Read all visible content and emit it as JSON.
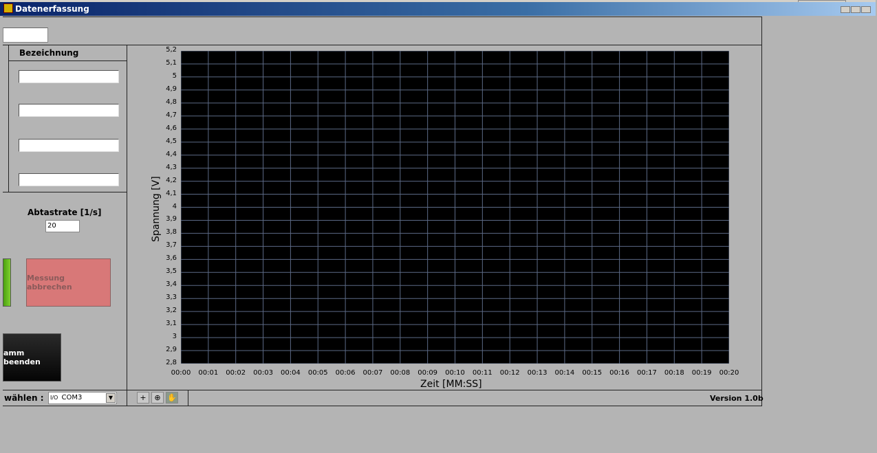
{
  "window": {
    "title": "Datenerfassung"
  },
  "channels": {
    "header": "Bezeichnung",
    "fields": [
      "",
      "",
      "",
      ""
    ]
  },
  "sampling": {
    "label": "Abtastrate [1/s]",
    "value": "20"
  },
  "buttons": {
    "abort": "Messung abbrechen",
    "quit": "amm beenden"
  },
  "port": {
    "label": "wählen :",
    "value": "COM3",
    "io_prefix": "I/O"
  },
  "graph": {
    "ylabel": "Spannung [V]",
    "xlabel": "Zeit [MM:SS]",
    "grid_color": "#5c6a86"
  },
  "version": "Version 1.0b",
  "chart_data": {
    "type": "line",
    "xlabel": "Zeit [MM:SS]",
    "ylabel": "Spannung [V]",
    "ylim": [
      2.8,
      5.2
    ],
    "yticks": [
      "2,8",
      "2,9",
      "3",
      "3,1",
      "3,2",
      "3,3",
      "3,4",
      "3,5",
      "3,6",
      "3,7",
      "3,8",
      "3,9",
      "4",
      "4,1",
      "4,2",
      "4,3",
      "4,4",
      "4,5",
      "4,6",
      "4,7",
      "4,8",
      "4,9",
      "5",
      "5,1",
      "5,2"
    ],
    "xticks": [
      "00:00",
      "00:01",
      "00:02",
      "00:03",
      "00:04",
      "00:05",
      "00:06",
      "00:07",
      "00:08",
      "00:09",
      "00:10",
      "00:11",
      "00:12",
      "00:13",
      "00:14",
      "00:15",
      "00:16",
      "00:17",
      "00:18",
      "00:19",
      "00:20"
    ],
    "series": [],
    "grid": true
  }
}
